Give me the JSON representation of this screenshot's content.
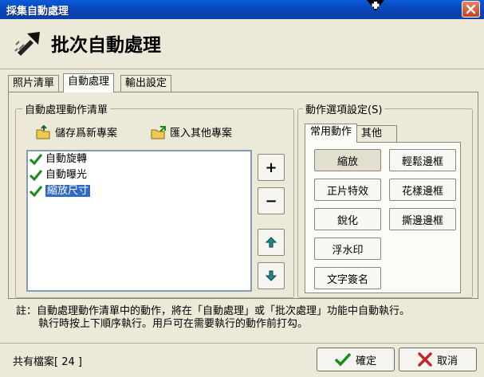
{
  "window": {
    "title": "採集自動處理"
  },
  "header": {
    "title": "批次自動處理"
  },
  "tabs": [
    {
      "label": "照片清單"
    },
    {
      "label": "自動處理"
    },
    {
      "label": "輸出設定"
    }
  ],
  "action_list": {
    "group_title": "自動處理動作清單",
    "save_label": "儲存爲新專案",
    "import_label": "匯入其他專案",
    "items": [
      {
        "label": "自動旋轉",
        "checked": true,
        "selected": false
      },
      {
        "label": "自動曝光",
        "checked": true,
        "selected": false
      },
      {
        "label": "縮放尺寸",
        "checked": true,
        "selected": true
      }
    ],
    "add_symbol": "+",
    "remove_symbol": "−"
  },
  "options": {
    "group_title": "動作選項設定(S)",
    "tabs": [
      {
        "label": "常用動作"
      },
      {
        "label": "其他"
      }
    ],
    "buttons": [
      {
        "label": "縮放"
      },
      {
        "label": "輕鬆邊框"
      },
      {
        "label": "正片特效"
      },
      {
        "label": "花樣邊框"
      },
      {
        "label": "銳化"
      },
      {
        "label": "撕邊邊框"
      },
      {
        "label": "浮水印"
      },
      {
        "label": "文字簽名"
      }
    ]
  },
  "note": {
    "line1": "註：自動處理動作清單中的動作，將在「自動處理」或「批次處理」功能中自動執行。",
    "line2": "執行時按上下順序執行。用戶可在需要執行的動作前打勾。"
  },
  "status": {
    "file_count": "共有檔案[ 24 ]"
  },
  "buttons": {
    "ok_label": "確定",
    "cancel_label": "取消"
  },
  "colors": {
    "titlebar": "#0842b3",
    "check": "#1a8a1a",
    "selection": "#316ac5",
    "cancel_x": "#c0282b"
  }
}
